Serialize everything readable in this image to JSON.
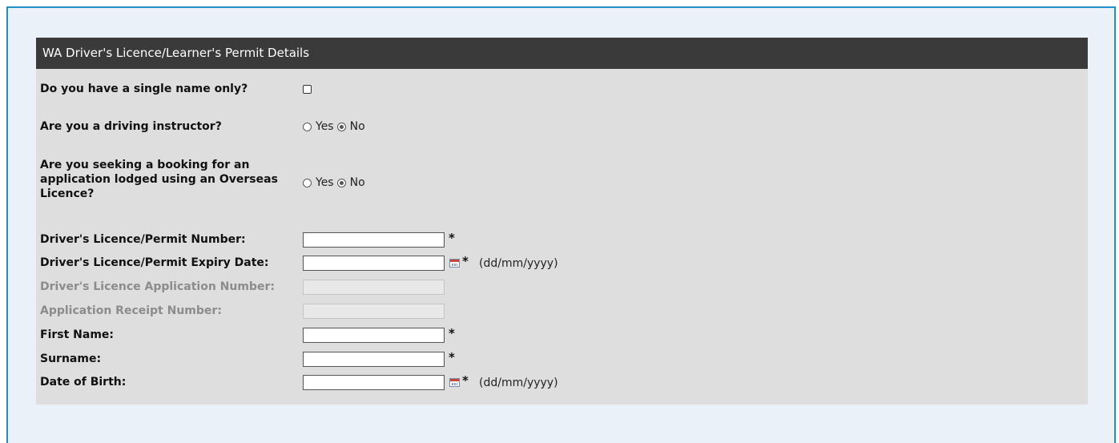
{
  "section": {
    "header": "WA Driver's Licence/Learner's Permit Details"
  },
  "questions": {
    "single_name": "Do you have a single name only?",
    "driving_instructor": "Are you a driving instructor?",
    "overseas_booking": "Are you seeking a booking for an application lodged using an Overseas Licence?",
    "yes_label": "Yes",
    "no_label": "No",
    "driving_instructor_selected": "No",
    "overseas_booking_selected": "No",
    "single_name_checked": false
  },
  "fields": {
    "licence_number": {
      "label": "Driver's Licence/Permit Number:",
      "value": "",
      "required": "*"
    },
    "expiry_date": {
      "label": "Driver's Licence/Permit Expiry Date:",
      "value": "",
      "required": "*",
      "hint": "(dd/mm/yyyy)"
    },
    "application_number": {
      "label": "Driver's Licence Application Number:",
      "value": ""
    },
    "receipt_number": {
      "label": "Application Receipt Number:",
      "value": ""
    },
    "first_name": {
      "label": "First Name:",
      "value": "",
      "required": "*"
    },
    "surname": {
      "label": "Surname:",
      "value": "",
      "required": "*"
    },
    "dob": {
      "label": "Date of Birth:",
      "value": "",
      "required": "*",
      "hint": "(dd/mm/yyyy)"
    }
  },
  "colors": {
    "frame_border": "#1f8fc6",
    "frame_background": "#eaf1f9",
    "panel_background": "#dedede",
    "header_background": "#3a3a3a",
    "disabled_label": "#8c8c8c"
  }
}
